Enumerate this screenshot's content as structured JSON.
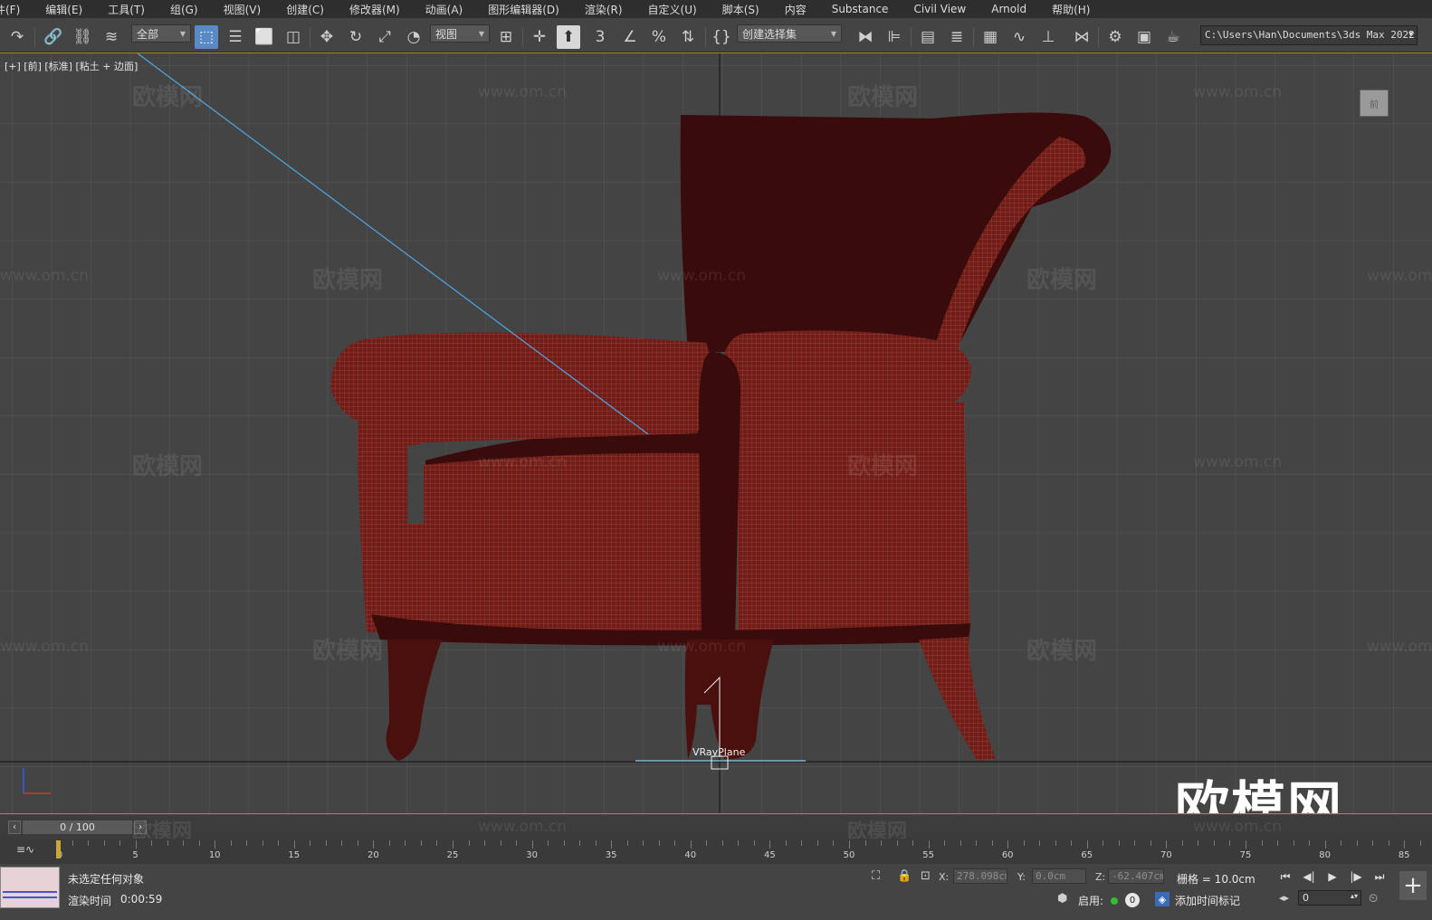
{
  "menu": {
    "items": [
      "件(F)",
      "编辑(E)",
      "工具(T)",
      "组(G)",
      "视图(V)",
      "创建(C)",
      "修改器(M)",
      "动画(A)",
      "图形编辑器(D)",
      "渲染(R)",
      "自定义(U)",
      "脚本(S)",
      "内容",
      "Substance",
      "Civil View",
      "Arnold",
      "帮助(H)"
    ]
  },
  "toolbar": {
    "filter_value": "全部",
    "ref_coord_value": "视图",
    "selection_set_value": "创建选择集",
    "project_path": "C:\\Users\\Han\\Documents\\3ds Max 2022",
    "icons": {
      "redo": "redo-icon",
      "link": "link-icon",
      "unlink": "unlink-icon",
      "bind_spacewarp": "bind-space-warp-icon",
      "select": "select-object-icon",
      "select_by_name": "select-by-name-icon",
      "rect_region": "rectangular-selection-icon",
      "window_crossing": "window-crossing-icon",
      "move": "move-icon",
      "rotate": "rotate-icon",
      "scale": "scale-icon",
      "placement": "placement-icon",
      "pivot": "pivot-icon",
      "keyboard_shortcut": "keyboard-shortcut-override-icon",
      "snap_toggle": "snap-toggle-icon",
      "angle_snap": "angle-snap-icon",
      "percent_snap": "percent-snap-icon",
      "spinner_snap": "spinner-snap-icon",
      "edit_named_sets": "edit-named-selection-sets-icon",
      "mirror": "mirror-icon",
      "align": "align-icon",
      "scene_explorer": "scene-explorer-icon",
      "layer_explorer": "layer-explorer-icon",
      "ribbon": "ribbon-icon",
      "curve_editor": "curve-editor-icon",
      "dope_sheet": "dope-sheet-icon",
      "schematic": "schematic-view-icon",
      "render_setup": "render-setup-icon",
      "rendered_frame": "rendered-frame-window-icon",
      "render": "render-production-icon"
    }
  },
  "viewport": {
    "label": "[+] [前] [标准] [粘土 + 边面]",
    "viewcube_label": "前",
    "object_label": "VRayPlane",
    "watermark_cn": "欧模网",
    "watermark_url": "www.om.cn",
    "watermark_big": "欧模网",
    "colors": {
      "background": "#444444",
      "grid": "#5a5a5a",
      "chair_dark": "#3a0b0b",
      "chair_mesh": "#7e2a23",
      "selection_line": "#4da8e8"
    }
  },
  "timeslider": {
    "frame_display": "0 / 100",
    "prev_icon": "chevron-left-icon",
    "next_icon": "chevron-right-icon"
  },
  "trackbar": {
    "labels": [
      "0",
      "5",
      "10",
      "15",
      "20",
      "25",
      "30",
      "35",
      "40",
      "45",
      "50",
      "55",
      "60",
      "65",
      "70",
      "75",
      "80",
      "85"
    ]
  },
  "statusbar": {
    "status_text": "未选定任何对象",
    "render_time_label": "渲染时间",
    "render_time_value": "0:00:59",
    "coords": {
      "x_label": "X:",
      "x_value": "278.098cm",
      "y_label": "Y:",
      "y_value": "0.0cm",
      "z_label": "Z:",
      "z_value": "-62.407cm"
    },
    "grid_text": "栅格 = 10.0cm",
    "enable_label": "启用:",
    "enable_count": "0",
    "add_time_tag": "添加时间标记",
    "frame_value": "0"
  }
}
